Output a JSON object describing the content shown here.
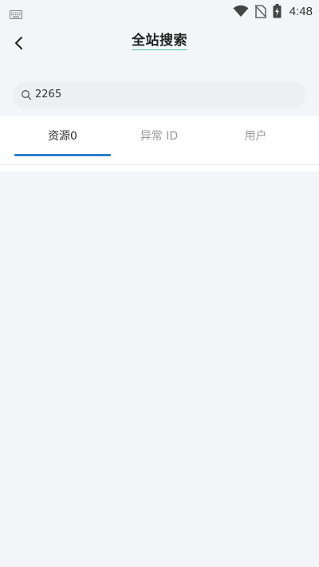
{
  "status_bar": {
    "time": "4:48",
    "icons": [
      "keyboard-icon",
      "wifi-icon",
      "no-sim-icon",
      "battery-charging-icon"
    ]
  },
  "header": {
    "title": "全站搜索",
    "back_icon": "back-arrow-icon",
    "title_underline_color": "#48c7a0"
  },
  "search": {
    "value": "2265",
    "icon": "search-icon"
  },
  "tabs": [
    {
      "label": "资源0",
      "active": true
    },
    {
      "label": "异常 ID",
      "active": false
    },
    {
      "label": "用户",
      "active": false
    }
  ],
  "colors": {
    "accent": "#2e7fd0",
    "background": "#f4f5f9",
    "tab_inactive": "#9a9aa0"
  }
}
